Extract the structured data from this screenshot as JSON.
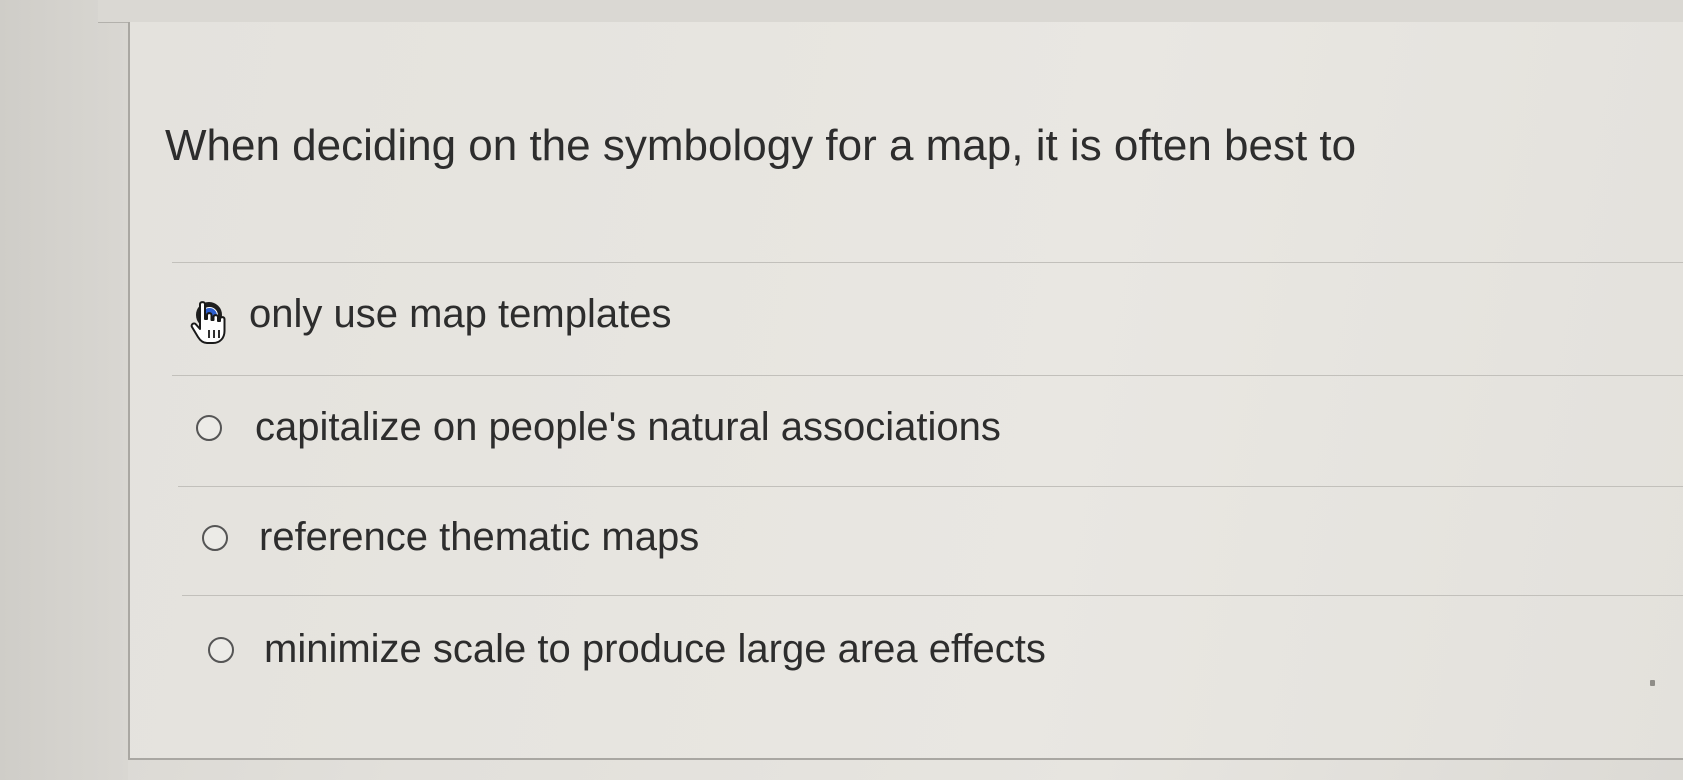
{
  "question": {
    "text": "When deciding on the symbology for a map, it is often best to"
  },
  "options": [
    {
      "label": "only use map templates",
      "selected": true
    },
    {
      "label": "capitalize on people's natural associations",
      "selected": false
    },
    {
      "label": "reference thematic maps",
      "selected": false
    },
    {
      "label": "minimize scale to produce large area effects",
      "selected": false
    }
  ],
  "colors": {
    "selected_radio": "#2d5fcf",
    "text": "#2d2d2d",
    "divider": "#c2c0bb"
  },
  "icons": {
    "cursor": "hand-pointer-icon"
  }
}
